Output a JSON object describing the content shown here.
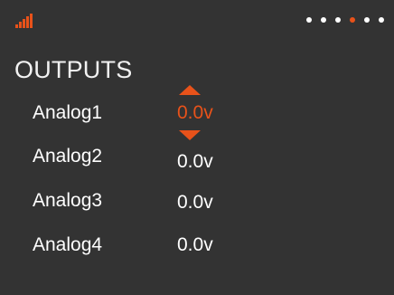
{
  "header": {
    "signal_icon": "signal-strength-icon",
    "signal_bars": 5,
    "pager": {
      "page_count": 6,
      "active_index": 3
    }
  },
  "title": "OUTPUTS",
  "outputs": [
    {
      "label": "Analog1",
      "value": "0.0v",
      "selected": true
    },
    {
      "label": "Analog2",
      "value": "0.0v",
      "selected": false
    },
    {
      "label": "Analog3",
      "value": "0.0v",
      "selected": false
    },
    {
      "label": "Analog4",
      "value": "0.0v",
      "selected": false
    }
  ],
  "stepper_icons": {
    "up": "arrow-up-icon",
    "down": "arrow-down-icon"
  },
  "colors": {
    "background": "#333333",
    "accent": "#e8521a",
    "text": "#ffffff"
  }
}
